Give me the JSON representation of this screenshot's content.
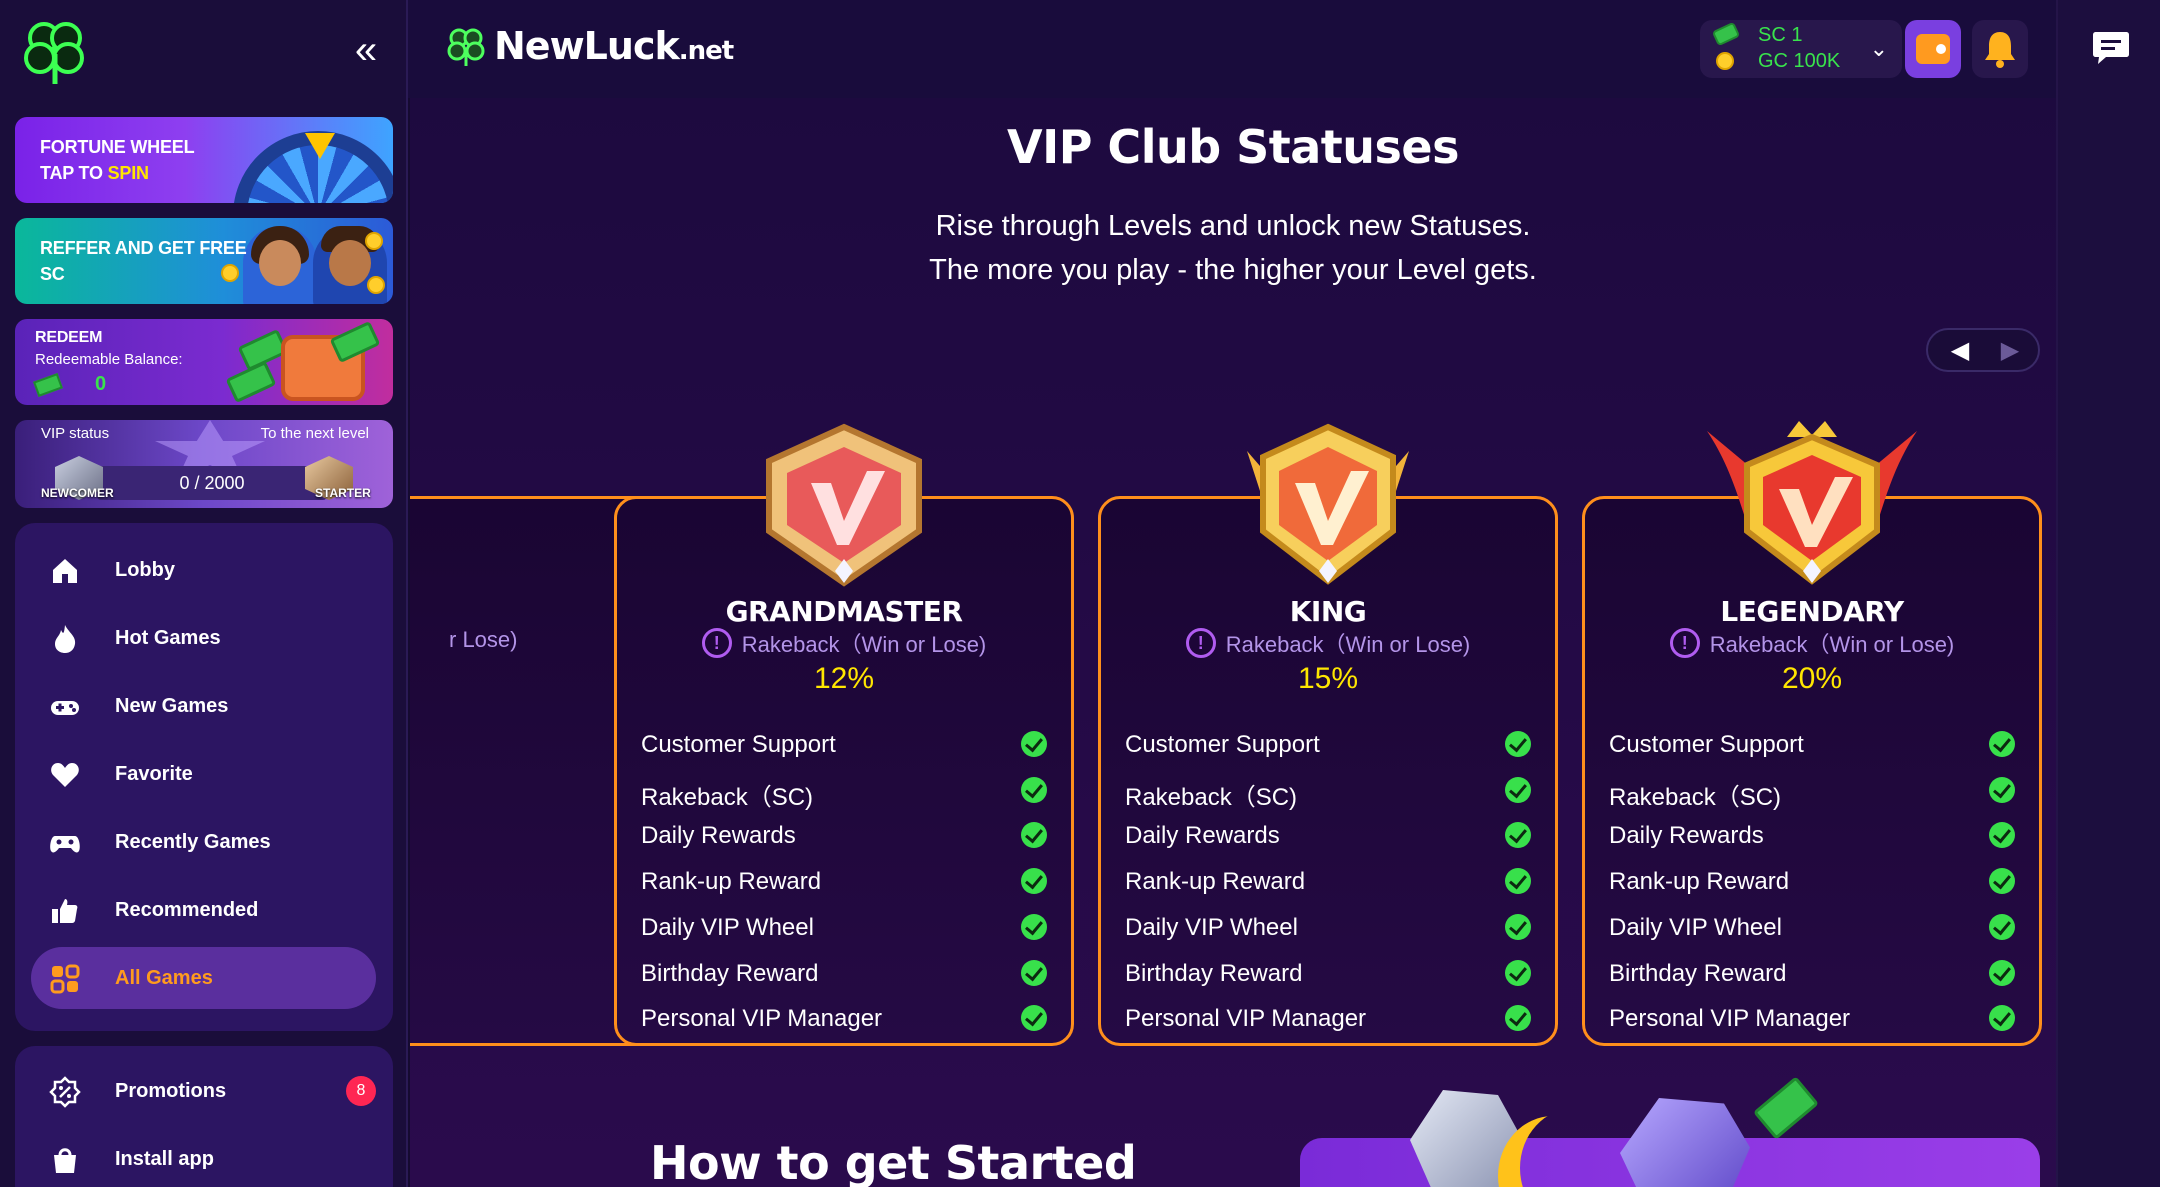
{
  "brand": {
    "name": "NewLuck",
    "tld": ".net"
  },
  "sidebar": {
    "collapse_icon": "«",
    "banners": {
      "wheel": {
        "line1": "FORTUNE WHEEL",
        "line2_prefix": "TAP TO ",
        "line2_highlight": "SPIN"
      },
      "refer": {
        "line1": "REFFER AND GET FREE",
        "line2": "SC"
      },
      "redeem": {
        "title": "REDEEM",
        "subtitle": "Redeemable Balance:",
        "value": "0"
      },
      "vip": {
        "status_label": "VIP status",
        "next_label": "To the next level",
        "progress_text": "0 / 2000",
        "progress_fraction": 0,
        "current_level": "NEWCOMER",
        "next_level": "STARTER"
      }
    },
    "nav": [
      {
        "label": "Lobby",
        "icon": "home-icon",
        "active": false
      },
      {
        "label": "Hot Games",
        "icon": "fire-icon",
        "active": false
      },
      {
        "label": "New Games",
        "icon": "controller-icon",
        "active": false
      },
      {
        "label": "Favorite",
        "icon": "heart-icon",
        "active": false
      },
      {
        "label": "Recently Games",
        "icon": "gamepad-icon",
        "active": false
      },
      {
        "label": "Recommended",
        "icon": "thumbs-up-icon",
        "active": false
      },
      {
        "label": "All Games",
        "icon": "grid-icon",
        "active": true
      }
    ],
    "extra_nav": [
      {
        "label": "Promotions",
        "icon": "discount-icon",
        "badge": "8"
      },
      {
        "label": "Install app",
        "icon": "bag-icon"
      }
    ]
  },
  "header": {
    "balances": [
      {
        "label": "SC 1"
      },
      {
        "label": "GC 100K"
      }
    ],
    "chevron": "⌄"
  },
  "main": {
    "title": "VIP Club Statuses",
    "subtitle_line1": "Rise through Levels and unlock new Statuses.",
    "subtitle_line2": "The more you play - the higher your Level gets.",
    "pager": {
      "prev": "◀",
      "next": "▶"
    },
    "partial_card": {
      "rake_text": "r Lose)"
    },
    "cards": [
      {
        "name": "GRANDMASTER",
        "rake_label": "Rakeback（Win or Lose)",
        "rake_pct": "12%",
        "crest_color": "#e85a5a"
      },
      {
        "name": "KING",
        "rake_label": "Rakeback（Win or Lose)",
        "rake_pct": "15%",
        "crest_color": "#f0a12a"
      },
      {
        "name": "LEGENDARY",
        "rake_label": "Rakeback（Win or Lose)",
        "rake_pct": "20%",
        "crest_color": "#e8392e"
      }
    ],
    "features": [
      "Customer Support",
      "Rakeback（SC)",
      "Daily Rewards",
      "Rank-up Reward",
      "Daily VIP Wheel",
      "Birthday Reward",
      "Personal VIP Manager"
    ],
    "info_glyph": "!",
    "howto_title": "How to get Started"
  },
  "colors": {
    "accent_orange": "#ff8f1c",
    "accent_yellow": "#ffe600",
    "check_green": "#38e04b",
    "sidebar_bg": "#1a0d3a"
  }
}
